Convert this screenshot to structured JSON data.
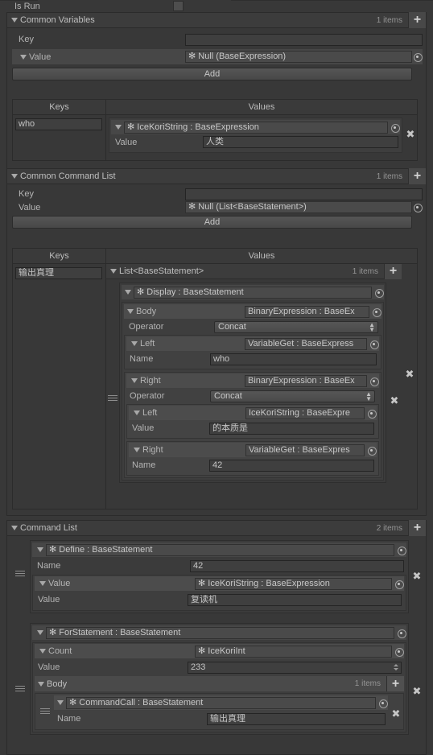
{
  "meta": {
    "theme_bg": "#383838",
    "accent_text": "#b8b8b8"
  },
  "top_row": {
    "label": "Is Run",
    "checked": false
  },
  "sections": [
    {
      "id": "common-variables",
      "title": "Common Variables",
      "count_label": "1 items",
      "plus_label": "+",
      "editor": {
        "key_label": "Key",
        "key_value": "",
        "key_placeholder": "",
        "value_label": "Value",
        "value_object": "✻ Null (BaseExpression)",
        "add_label": "Add"
      },
      "table": {
        "keys_header": "Keys",
        "values_header": "Values",
        "rows": [
          {
            "key": "who",
            "value_object": "✻ IceKoriString : BaseExpression",
            "fields": [
              {
                "label": "Value",
                "value": "人类"
              }
            ],
            "remove_label": "✖"
          }
        ]
      }
    },
    {
      "id": "common-command-list",
      "title": "Common Command List",
      "count_label": "1 items",
      "plus_label": "+",
      "editor": {
        "key_label": "Key",
        "key_value": "",
        "value_label": "Value",
        "value_object": "✻ Null (List<BaseStatement>)",
        "add_label": "Add"
      },
      "table": {
        "keys_header": "Keys",
        "values_header": "Values",
        "row_key": "输出真理",
        "list_title": "List<BaseStatement>",
        "list_count": "1 items",
        "list_plus": "+",
        "statement": {
          "type_label": "✻ Display : BaseStatement",
          "body": {
            "label": "Body",
            "type_label": "BinaryExpression : BaseEx",
            "operator_label": "Operator",
            "operator_value": "Concat",
            "left": {
              "label": "Left",
              "type_label": "VariableGet : BaseExpress",
              "name_label": "Name",
              "name_value": "who"
            },
            "right": {
              "label": "Right",
              "type_label": "BinaryExpression : BaseEx",
              "operator_label": "Operator",
              "operator_value": "Concat",
              "left": {
                "label": "Left",
                "type_label": "IceKoriString : BaseExpre",
                "value_label": "Value",
                "value_value": "的本质是"
              },
              "right": {
                "label": "Right",
                "type_label": "VariableGet : BaseExpres",
                "name_label": "Name",
                "name_value": "42"
              }
            }
          }
        },
        "remove_label": "✖",
        "remove_outer_label": "✖"
      }
    },
    {
      "id": "command-list",
      "title": "Command List",
      "count_label": "2 items",
      "plus_label": "+",
      "items": [
        {
          "type_label": "✻ Define : BaseStatement",
          "name_label": "Name",
          "name_value": "42",
          "value_label": "Value",
          "value_type": "✻ IceKoriString : BaseExpression",
          "inner_value_label": "Value",
          "inner_value_value": "复读机",
          "remove_label": "✖"
        },
        {
          "type_label": "✻ ForStatement : BaseStatement",
          "count_label": "Count",
          "count_type": "✻ IceKoriInt",
          "count_value_label": "Value",
          "count_value": "233",
          "body_label": "Body",
          "body_count": "1 items",
          "body_plus": "+",
          "body_item": {
            "type_label": "✻ CommandCall : BaseStatement",
            "name_label": "Name",
            "name_value": "输出真理",
            "remove_label": "✖"
          },
          "remove_label": "✖"
        }
      ]
    }
  ]
}
